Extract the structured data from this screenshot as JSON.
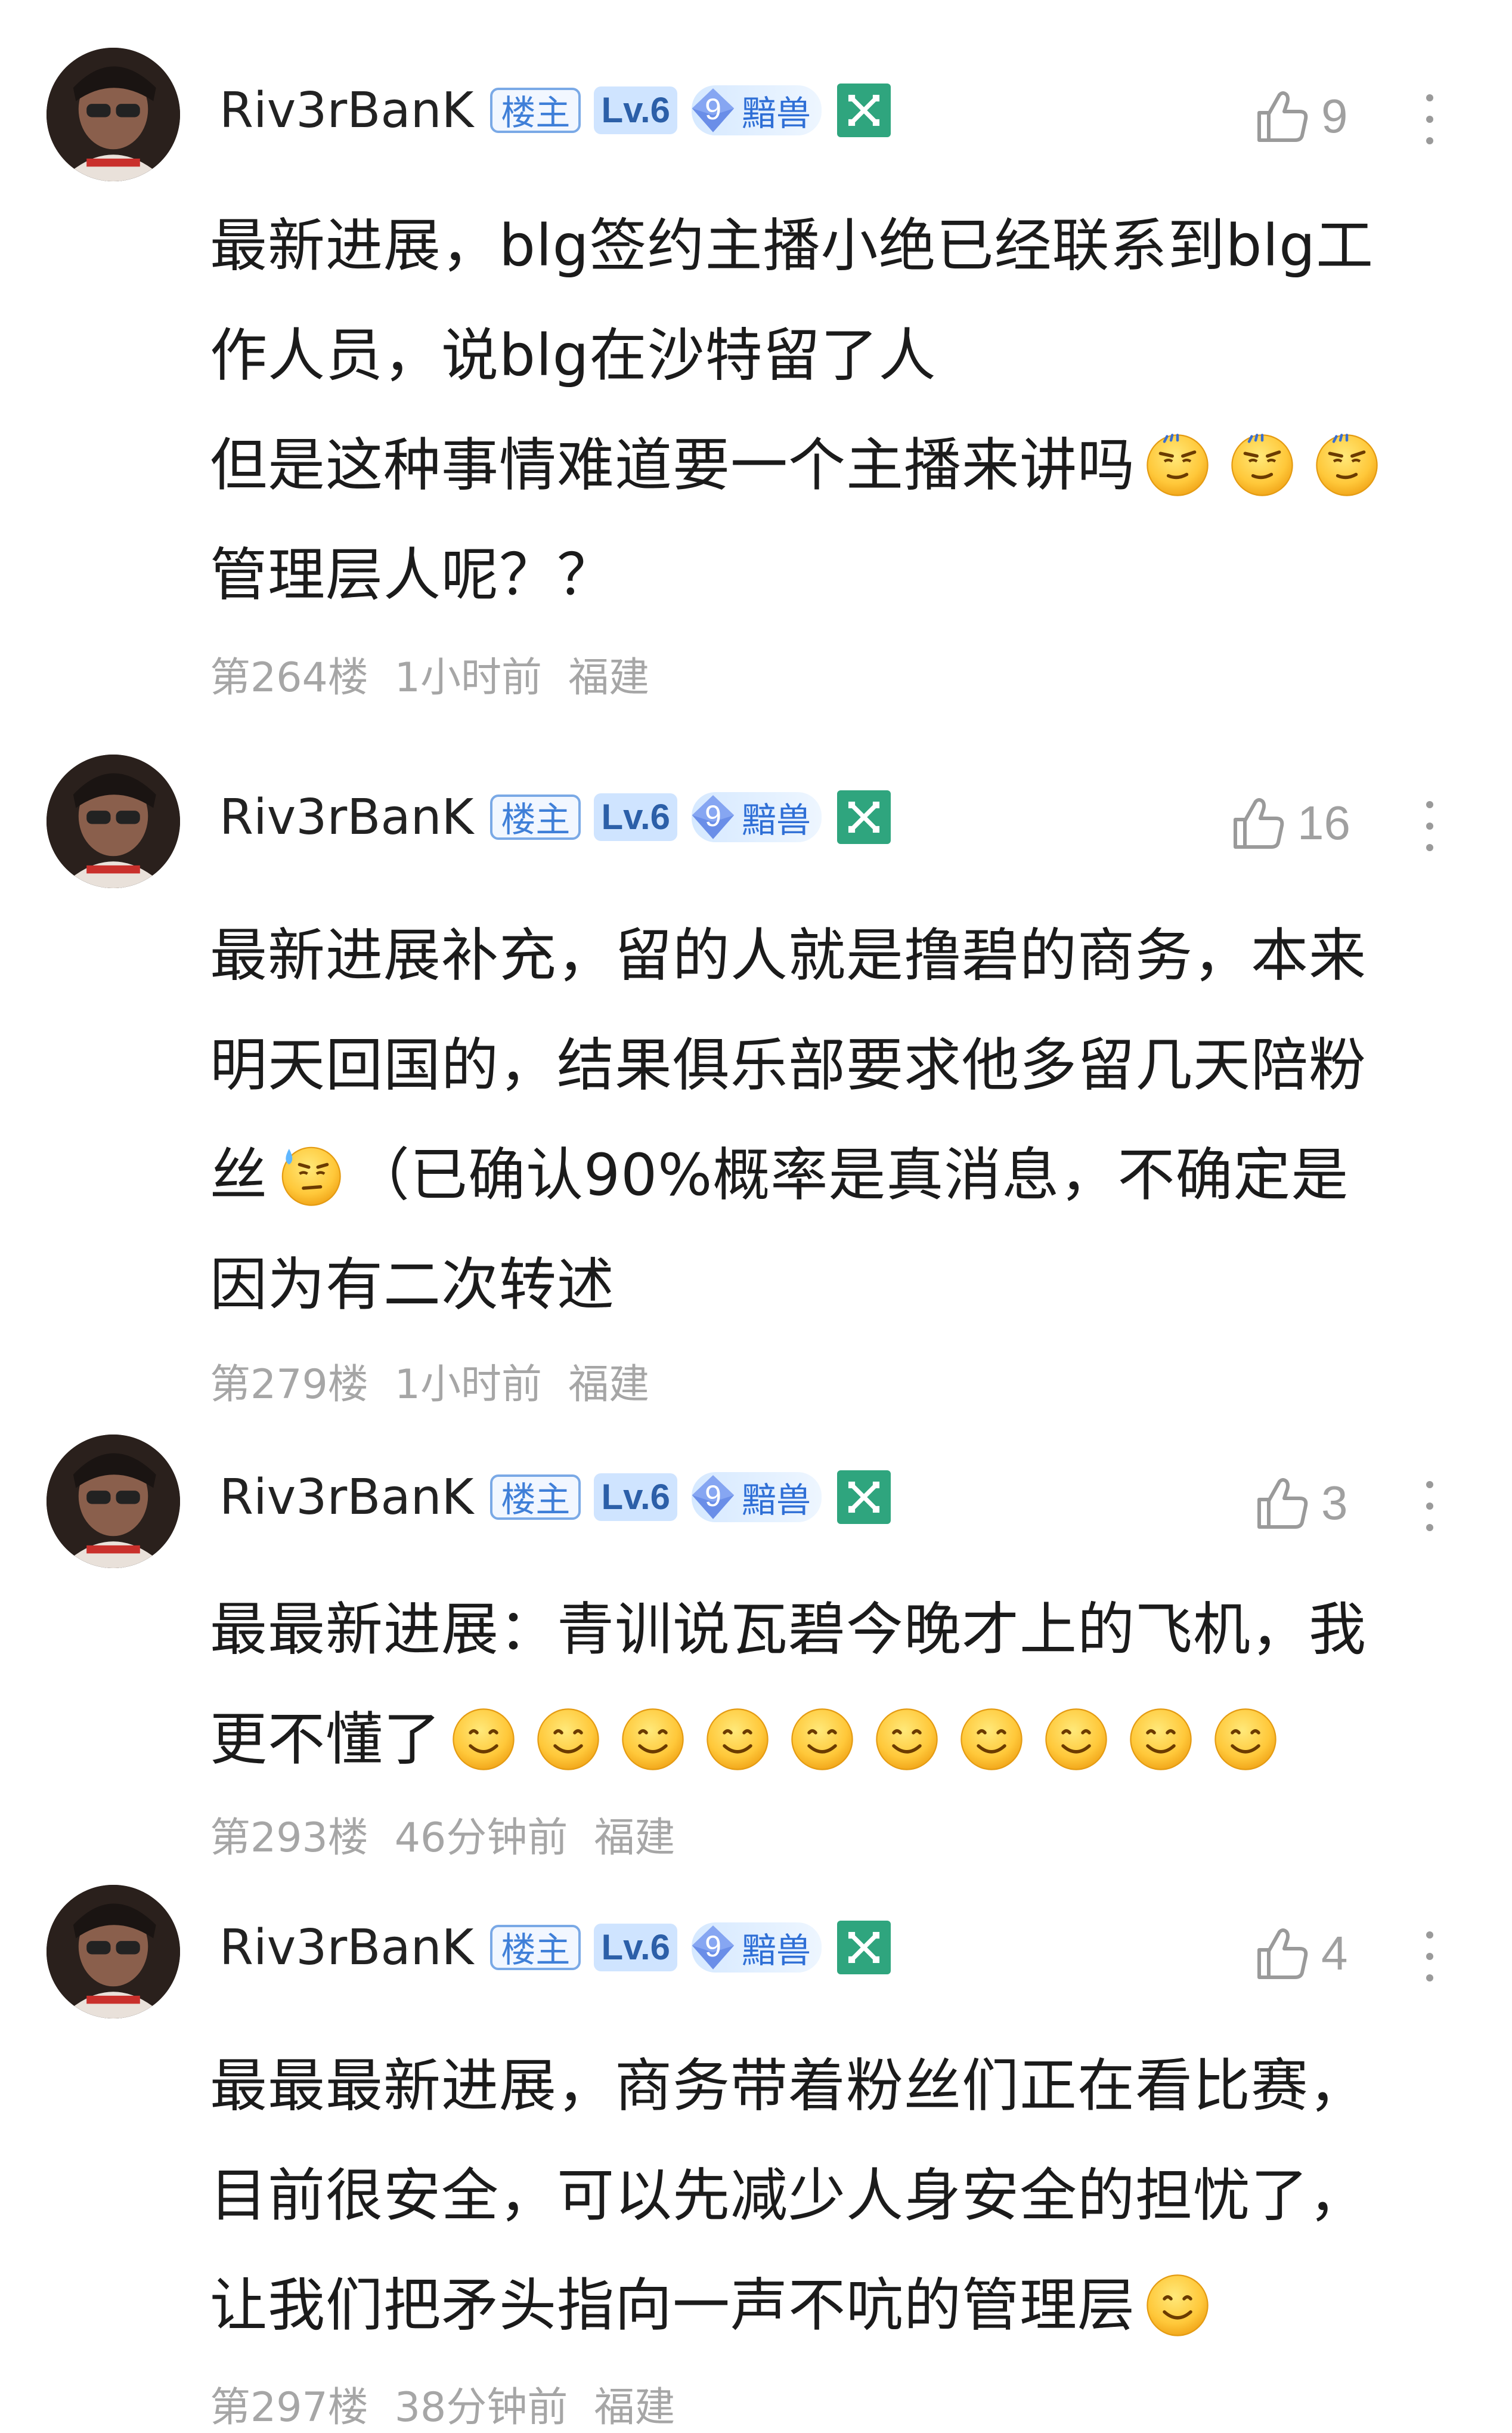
{
  "posts": [
    {
      "username": "Riv3rBanK",
      "owner_badge": "楼主",
      "level": "Lv.6",
      "fan_level": "9",
      "fan_name": "黯兽",
      "green_badge_icon": "crossed-swords-icon",
      "likes": "9",
      "content_lines": [
        "最新进展，blg签约主播小绝已经联系到blg工",
        "作人员，说blg在沙特留了人",
        "但是这种事情难道要一个主播来讲吗",
        "管理层人呢？？"
      ],
      "emojis": [
        "thinking-face-icon",
        "thinking-face-icon",
        "thinking-face-icon"
      ],
      "floor": "第264楼",
      "time": "1小时前",
      "location": "福建"
    },
    {
      "username": "Riv3rBanK",
      "owner_badge": "楼主",
      "level": "Lv.6",
      "fan_level": "9",
      "fan_name": "黯兽",
      "green_badge_icon": "crossed-swords-icon",
      "likes": "16",
      "content_lines": [
        "最新进展补充，留的人就是撸碧的商务，本来",
        "明天回国的，结果俱乐部要求他多留几天陪粉",
        "丝",
        "（已确认90%概率是真消息，不确定是",
        "因为有二次转述"
      ],
      "emojis": [
        "sweat-face-icon"
      ],
      "floor": "第279楼",
      "time": "1小时前",
      "location": "福建"
    },
    {
      "username": "Riv3rBanK",
      "owner_badge": "楼主",
      "level": "Lv.6",
      "fan_level": "9",
      "fan_name": "黯兽",
      "green_badge_icon": "crossed-swords-icon",
      "likes": "3",
      "content_lines": [
        "最最新进展：青训说瓦碧今晚才上的飞机，我",
        "更不懂了"
      ],
      "emojis": [
        "smile-face-icon",
        "smile-face-icon",
        "smile-face-icon",
        "smile-face-icon",
        "smile-face-icon",
        "smile-face-icon",
        "smile-face-icon",
        "smile-face-icon",
        "smile-face-icon",
        "smile-face-icon"
      ],
      "floor": "第293楼",
      "time": "46分钟前",
      "location": "福建"
    },
    {
      "username": "Riv3rBanK",
      "owner_badge": "楼主",
      "level": "Lv.6",
      "fan_level": "9",
      "fan_name": "黯兽",
      "green_badge_icon": "crossed-swords-icon",
      "likes": "4",
      "content_lines": [
        "最最最新进展，商务带着粉丝们正在看比赛，",
        "目前很安全，可以先减少人身安全的担忧了，",
        "让我们把矛头指向一声不吭的管理层"
      ],
      "emojis": [
        "smile-face-icon"
      ],
      "floor": "第297楼",
      "time": "38分钟前",
      "location": "福建"
    }
  ],
  "colors": {
    "owner_badge_border": "#7aa9e6",
    "level_badge_bg": "#cfe4ff",
    "fan_badge_text": "#2f6fd6",
    "green_badge": "#2fa57e",
    "meta_text": "#a6a6a6"
  }
}
